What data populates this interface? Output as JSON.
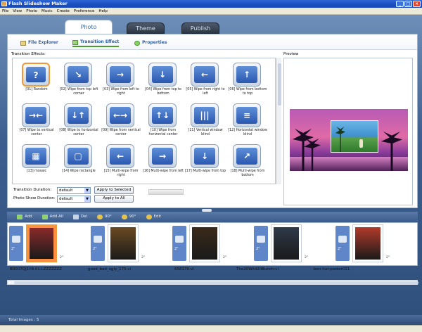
{
  "window": {
    "title": "Flash Slideshow Maker",
    "buttons": [
      "_",
      "□",
      "×"
    ]
  },
  "menu": [
    "File",
    "View",
    "Photo",
    "Music",
    "Create",
    "Preference",
    "Help"
  ],
  "main_tabs": [
    "Photo",
    "Theme",
    "Publish"
  ],
  "sub_tabs": [
    "File Explorer",
    "Transition Effect",
    "Properties"
  ],
  "effects_label": "Transition Effects:",
  "effects": [
    {
      "caption": "[01] Random",
      "glyph": "?"
    },
    {
      "caption": "[02] Wipe from top left corner",
      "glyph": "↘"
    },
    {
      "caption": "[03] Wipe from left to right",
      "glyph": "→"
    },
    {
      "caption": "[04] Wipe from top to bottom",
      "glyph": "↓"
    },
    {
      "caption": "[05] Wipe from right to left",
      "glyph": "←"
    },
    {
      "caption": "[06] Wipe from bottom to top",
      "glyph": "↑"
    },
    {
      "caption": "[07] Wipe to vertical center",
      "glyph": "→←"
    },
    {
      "caption": "[08] Wipe to horizontal center",
      "glyph": "↓↑"
    },
    {
      "caption": "[09] Wipe from vertical center",
      "glyph": "←→"
    },
    {
      "caption": "[10] Wipe from horizontal center",
      "glyph": "↑↓"
    },
    {
      "caption": "[11] Vertical window blind",
      "glyph": "|||"
    },
    {
      "caption": "[12] Horizontal window blind",
      "glyph": "≡"
    },
    {
      "caption": "[13] mosaic",
      "glyph": "▦"
    },
    {
      "caption": "[14] Wipe rectangle",
      "glyph": "▢"
    },
    {
      "caption": "[15] Multi-wipe from right",
      "glyph": "←"
    },
    {
      "caption": "[16] Multi-wipe from left",
      "glyph": "→"
    },
    {
      "caption": "[17] Multi-wipe from top",
      "glyph": "↓"
    },
    {
      "caption": "[18] Multi-wipe from bottom",
      "glyph": "↗"
    }
  ],
  "transition_duration": {
    "label": "Transition Duration:",
    "value": "default",
    "button": "Apply to Selected"
  },
  "photo_show_duration": {
    "label": "Photo Show Duration:",
    "value": "default",
    "button": "Apply to All"
  },
  "preview_label": "Preview",
  "toolbar": [
    "Add",
    "Add All",
    "Del",
    "90°",
    "90°",
    "Edit"
  ],
  "photos": [
    {
      "filename": "B0007QJ1Y8.01.LZZZZZZZ",
      "duration": "2\"",
      "selected": true,
      "color": "#8a2a2a"
    },
    {
      "filename": "good_bad_ugly_175-vi",
      "duration": "2\"",
      "selected": false,
      "color": "#6b4a22"
    },
    {
      "filename": "658170-vi",
      "duration": "2\"",
      "selected": false,
      "color": "#3a2a1a"
    },
    {
      "filename": "The20Wild20Bunch-vi",
      "duration": "2\"",
      "selected": false,
      "color": "#2f3a4a"
    },
    {
      "filename": "ben-hur-poster011",
      "duration": "2\"",
      "selected": false,
      "color": "#b23a2a"
    }
  ],
  "transition_label": "2\"",
  "status": "Total Images : 5"
}
